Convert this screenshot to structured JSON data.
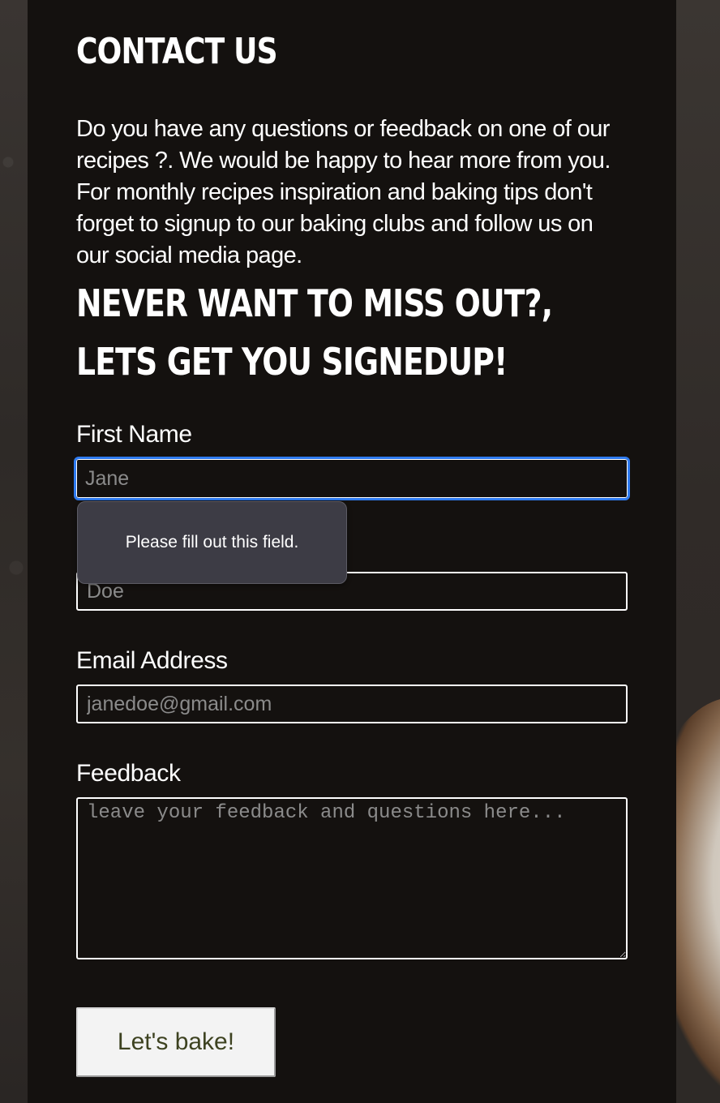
{
  "contact": {
    "heading": "CONTACT US",
    "intro": "Do you have any questions or feedback on one of our recipes ?. We would be happy to hear more from you. For monthly recipes inspiration and baking tips don't forget to signup to our baking clubs and follow us on our social media page."
  },
  "signup": {
    "heading": "NEVER WANT TO MISS OUT?, LETS GET YOU SIGNEDUP!"
  },
  "form": {
    "first_name": {
      "label": "First Name",
      "placeholder": "Jane"
    },
    "last_name": {
      "placeholder": "Doe"
    },
    "email": {
      "label": "Email Address",
      "placeholder": "janedoe@gmail.com"
    },
    "feedback": {
      "label": "Feedback",
      "placeholder": "leave your feedback and questions here..."
    },
    "submit_label": "Let's bake!"
  },
  "validation": {
    "message": "Please fill out this field."
  },
  "colors": {
    "panel_bg": "#14110f",
    "focus_ring": "#2f7bf0",
    "button_text": "#3d4220"
  }
}
